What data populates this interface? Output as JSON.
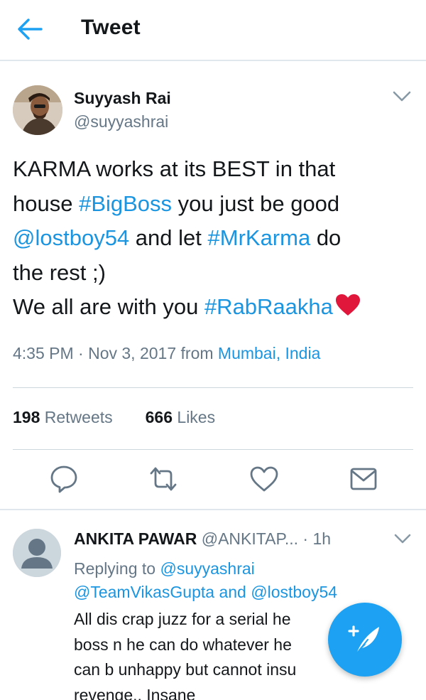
{
  "header": {
    "title": "Tweet"
  },
  "tweet": {
    "author_name": "Suyyash Rai",
    "author_handle": "@suyyashrai",
    "text": {
      "line1": "KARMA works at its BEST in that",
      "line2_a": "house ",
      "line2_tag": "#BigBoss",
      "line2_b": " you just be good",
      "line3_mention": "@lostboy54",
      "line3_a": " and let ",
      "line3_tag": "#MrKarma",
      "line3_b": " do",
      "line4": "the rest ;)",
      "line5_a": "We all are with you ",
      "line5_tag": "#RabRaakha"
    },
    "time": "4:35 PM · Nov 3, 2017 from ",
    "location": "Mumbai, India",
    "retweets_count": "198",
    "retweets_label": "Retweets",
    "likes_count": "666",
    "likes_label": "Likes"
  },
  "actions": [
    "reply-icon",
    "retweet-icon",
    "like-icon",
    "share-icon"
  ],
  "reply": {
    "name": "ANKITA PAWAR",
    "handle": "@ANKITAP...",
    "time": "· 1h",
    "replying_prefix": "Replying to ",
    "replying_mention1": "@suyyashrai",
    "replying_mention2": "@TeamVikasGupta",
    "replying_and": " and ",
    "replying_mention3": "@lostboy54",
    "line1": "All dis crap juzz for a serial he",
    "line2": "boss n he can do whatever he",
    "line3": "can b unhappy but cannot insu",
    "line4": "revenge.. Insane"
  },
  "colors": {
    "link": "#1b95e0",
    "fab": "#1da1f2",
    "muted": "#657786",
    "heart": "#e0163b"
  }
}
